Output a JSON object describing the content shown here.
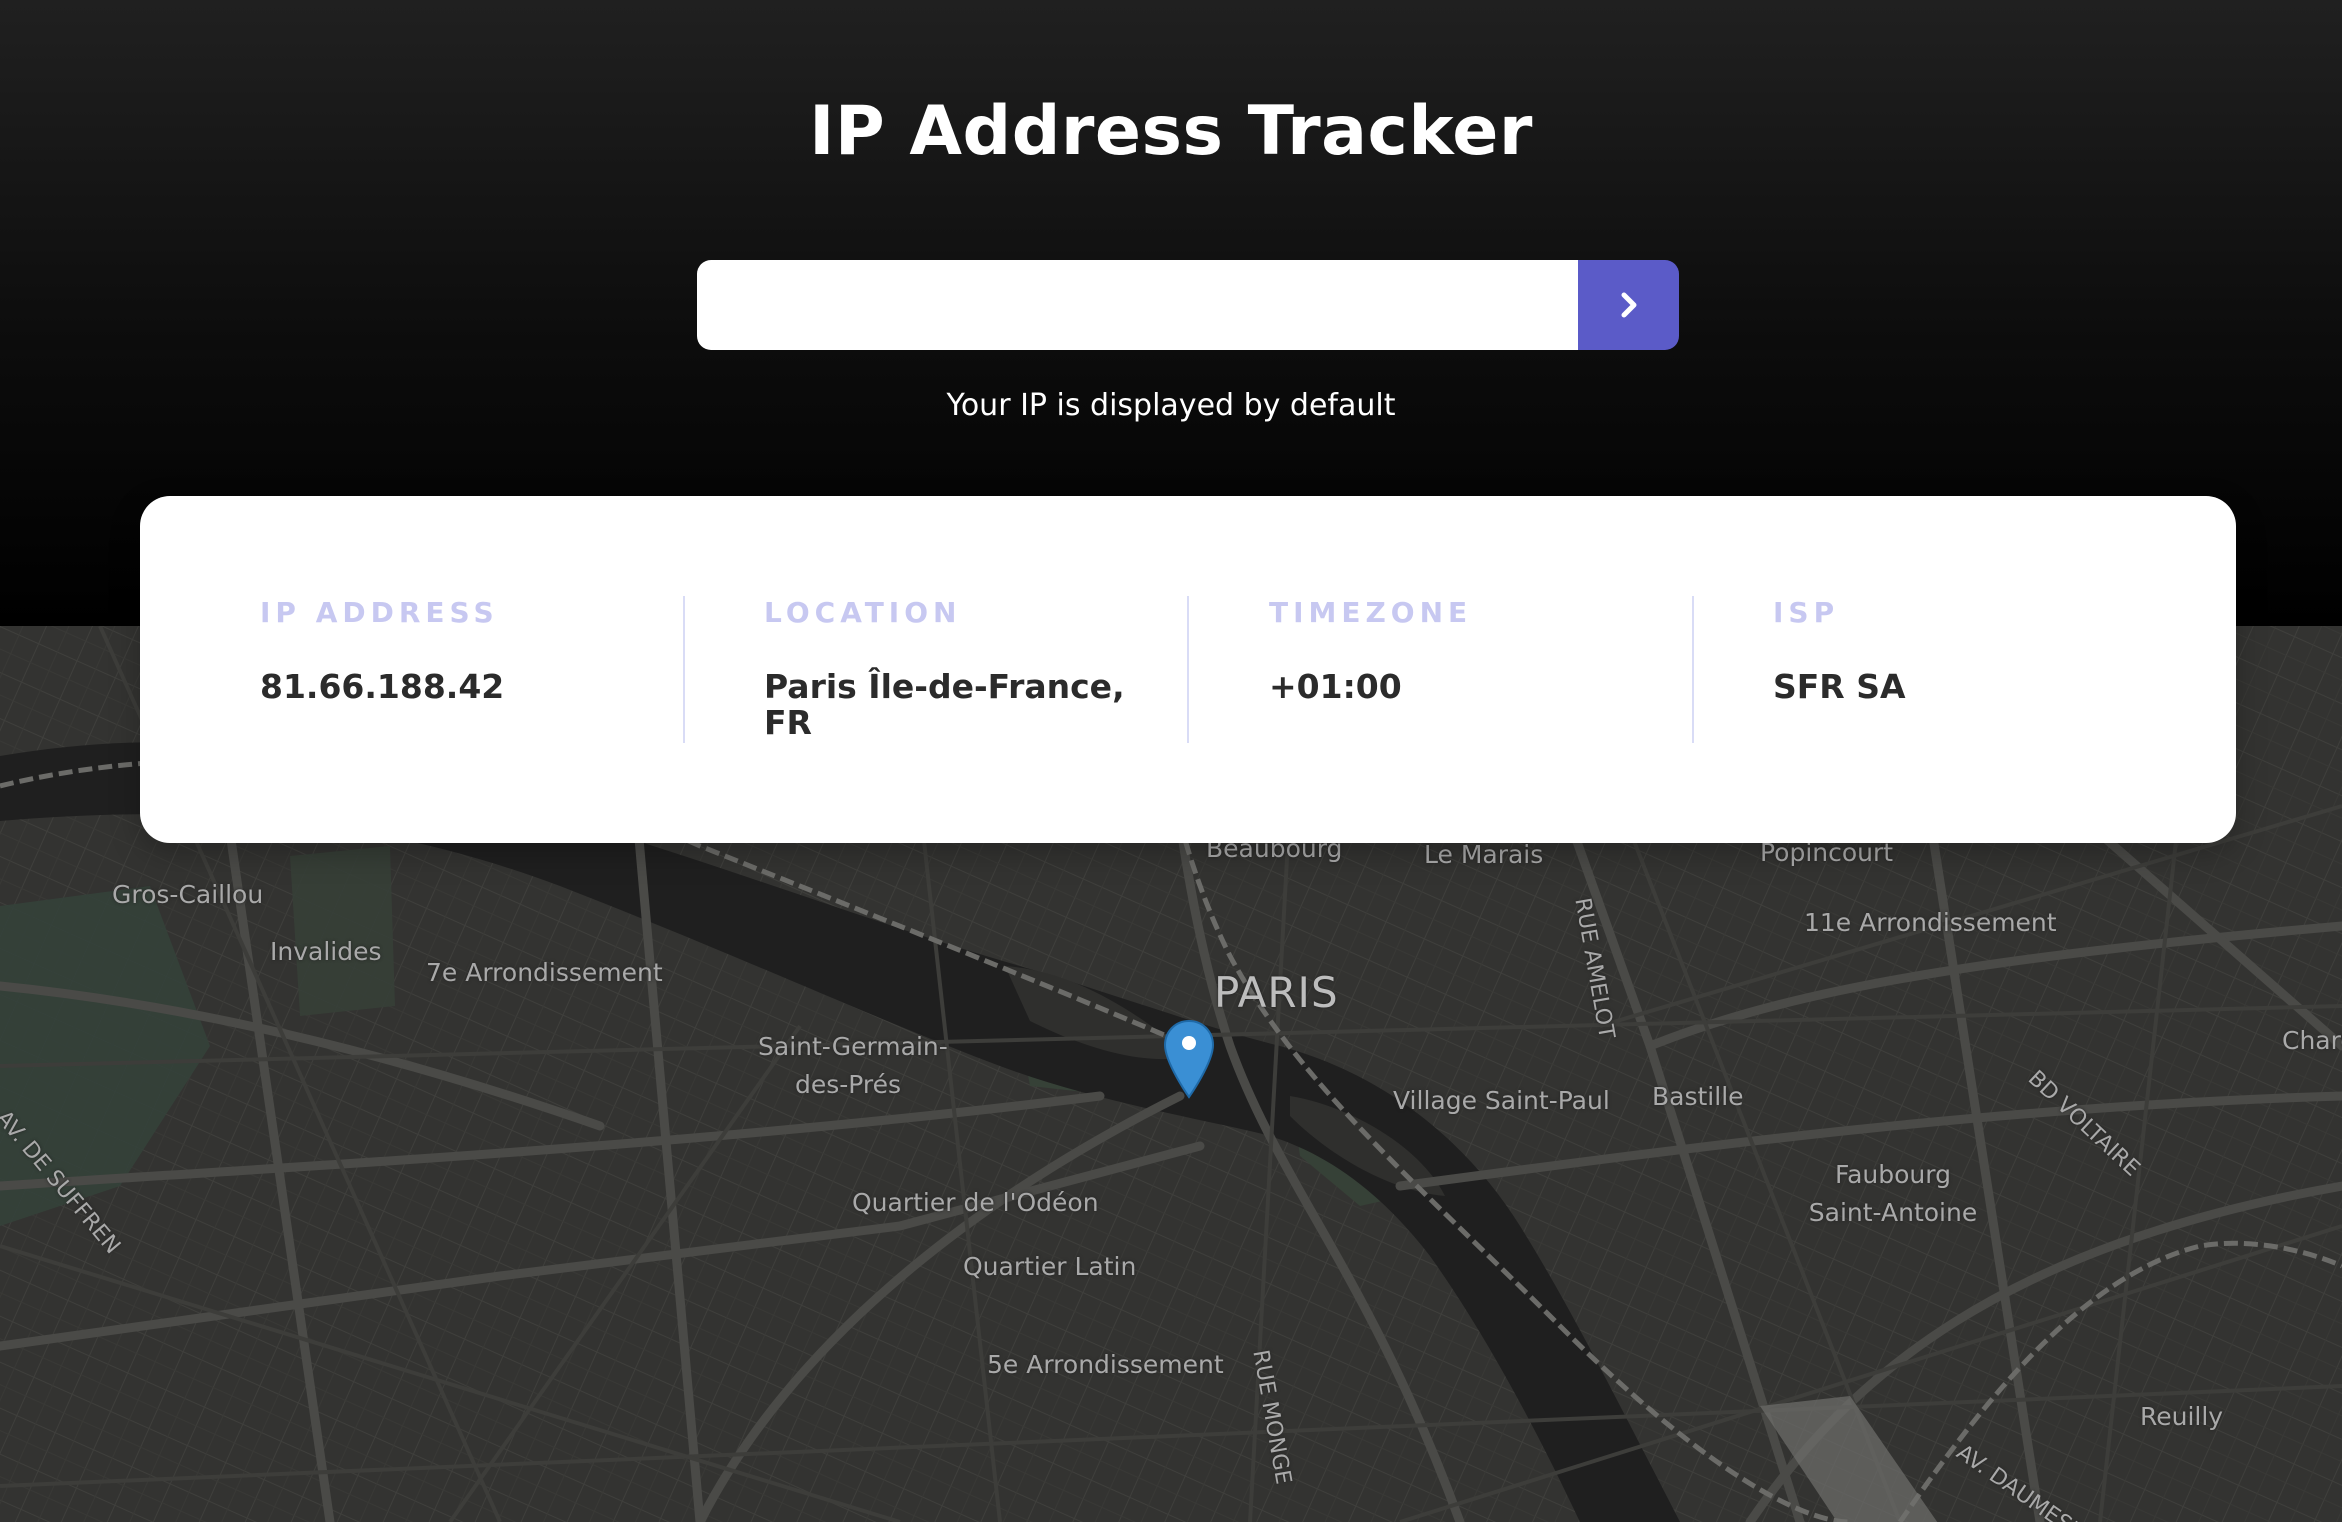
{
  "header": {
    "title": "IP Address Tracker",
    "search_placeholder": "",
    "search_value": "",
    "submit_icon": "chevron-right-icon",
    "hint": "Your IP is displayed by default",
    "accent_color": "#5b5bc8"
  },
  "info": {
    "ip": {
      "label": "IP ADDRESS",
      "value": "81.66.188.42"
    },
    "location": {
      "label": "LOCATION",
      "value_line1": "Paris Île-de-France,",
      "value_line2": "FR"
    },
    "timezone": {
      "label": "TIMEZONE",
      "value": "+01:00"
    },
    "isp": {
      "label": "ISP",
      "value": "SFR SA"
    }
  },
  "map": {
    "labels": {
      "beaubourg": "Beaubourg",
      "le_marais": "Le Marais",
      "rue_amelot": "RUE AMELOT",
      "popincourt": "Popincourt",
      "arr11": "11e Arrondissement",
      "gros_caillou": "Gros-Caillou",
      "invalides": "Invalides",
      "arr7": "7e Arrondissement",
      "paris": "PARIS",
      "st_germain_1": "Saint-Germain-",
      "st_germain_2": "des-Prés",
      "village_st_paul": "Village Saint-Paul",
      "bastille": "Bastille",
      "charonne": "Charo",
      "bd_voltaire": "BD VOLTAIRE",
      "av_suffren": "AV. DE SUFFREN",
      "faubourg_1": "Faubourg",
      "faubourg_2": "Saint-Antoine",
      "odeon": "Quartier de l'Odéon",
      "latin": "Quartier Latin",
      "arr5": "5e Arrondissement",
      "rue_monge": "RUE MONGE",
      "reuilly": "Reuilly",
      "av_daumesnil": "AV. DAUMESNIL"
    },
    "marker_icon": "map-pin-icon",
    "marker_color": "#3a8fd4"
  }
}
